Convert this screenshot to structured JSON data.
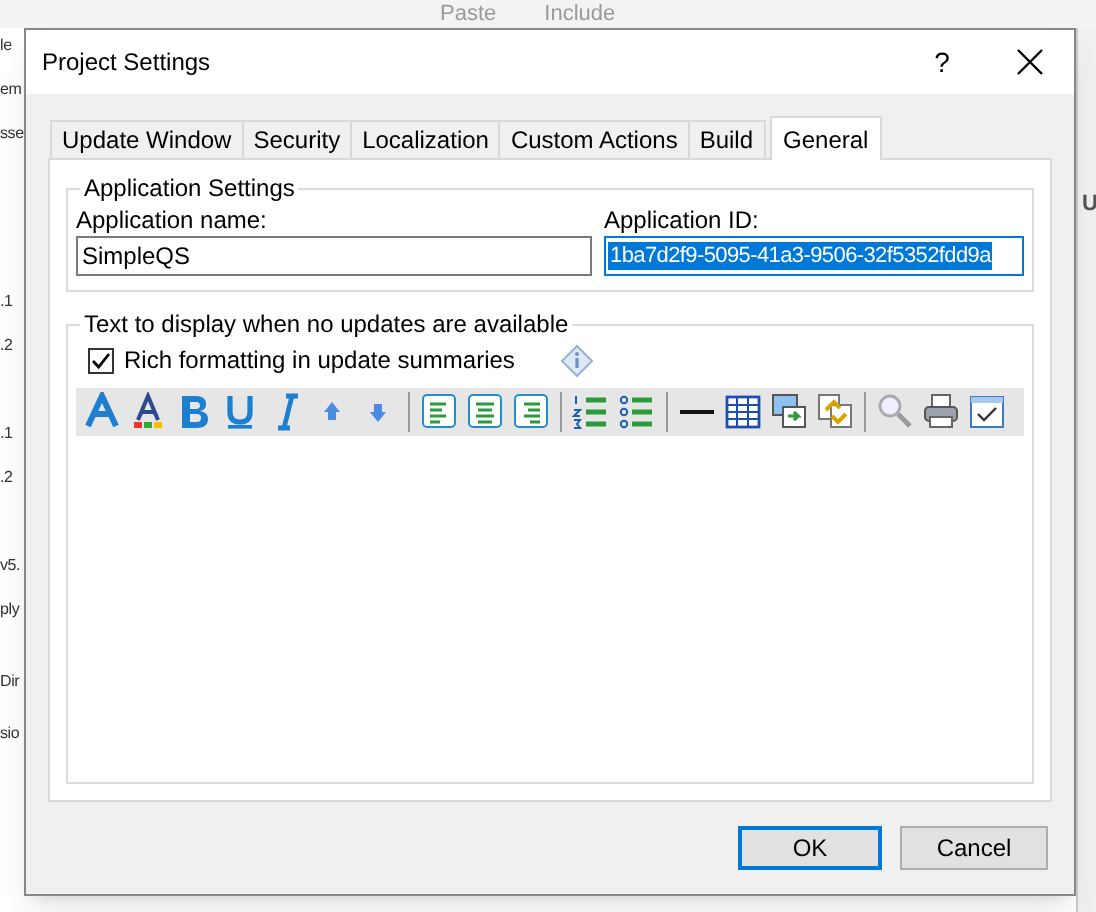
{
  "background_app": {
    "toolbar": [
      "Paste",
      "Include"
    ],
    "side_fragments": [
      "le",
      "em",
      "sse",
      ".1",
      ".2",
      ".1",
      ".2",
      "v5.",
      "ply",
      "Dir",
      "sio"
    ],
    "right_fragment": "U"
  },
  "window": {
    "title": "Project Settings",
    "help": "?"
  },
  "tabs": [
    {
      "label": "Update Window",
      "selected": false
    },
    {
      "label": "Security",
      "selected": false
    },
    {
      "label": "Localization",
      "selected": false
    },
    {
      "label": "Custom Actions",
      "selected": false
    },
    {
      "label": "Build",
      "selected": false
    },
    {
      "label": "General",
      "selected": true
    }
  ],
  "application_settings": {
    "title": "Application Settings",
    "name_label": "Application name:",
    "name_value": "SimpleQS",
    "id_label": "Application ID:",
    "id_value": "1ba7d2f9-5095-41a3-9506-32f5352fdd9a",
    "id_selected": true
  },
  "no_updates_text": {
    "title": "Text to display when no updates are available",
    "rich_formatting": {
      "label": "Rich formatting in update summaries",
      "checked": true
    }
  },
  "buttons": [
    {
      "label": "OK",
      "default": true
    },
    {
      "label": "Cancel",
      "default": false
    }
  ]
}
